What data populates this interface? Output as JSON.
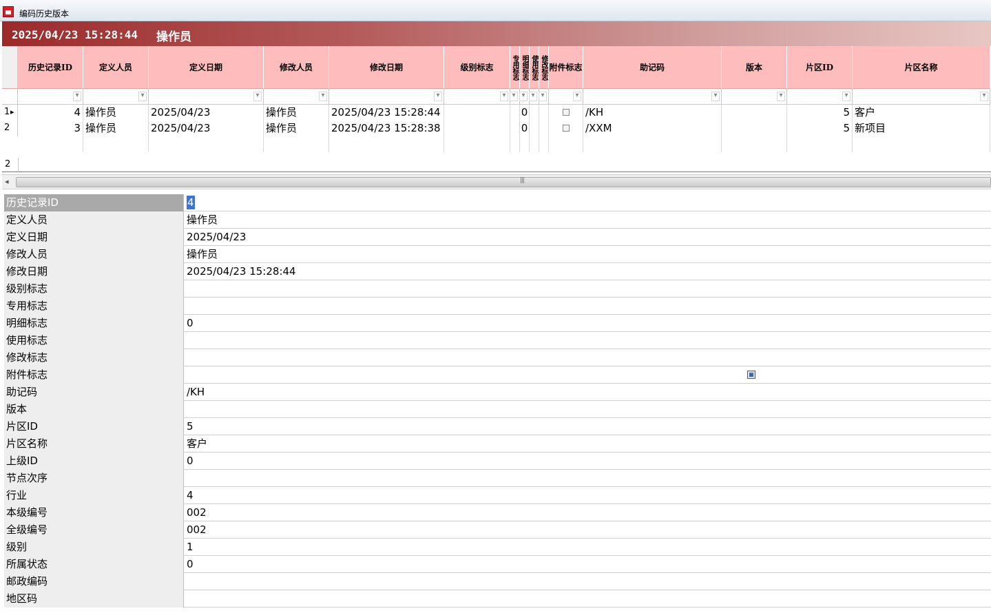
{
  "window": {
    "title": "编码历史版本"
  },
  "banner": {
    "datetime": "2025/04/23 15:28:44",
    "user": "操作员"
  },
  "grid": {
    "columns": [
      {
        "key": "id",
        "label": "历史记录ID"
      },
      {
        "key": "creator",
        "label": "定义人员"
      },
      {
        "key": "created",
        "label": "定义日期"
      },
      {
        "key": "modifier",
        "label": "修改人员"
      },
      {
        "key": "modified",
        "label": "修改日期"
      },
      {
        "key": "level_flag",
        "label": "级别标志"
      },
      {
        "key": "special_flag",
        "label": "专用标志"
      },
      {
        "key": "detail_flag",
        "label": "明细标志"
      },
      {
        "key": "use_flag",
        "label": "使用标志"
      },
      {
        "key": "modify_flag",
        "label": "修改标志"
      },
      {
        "key": "attach_flag",
        "label": "附件标志"
      },
      {
        "key": "mnemonic",
        "label": "助记码"
      },
      {
        "key": "version",
        "label": "版本"
      },
      {
        "key": "zone_id",
        "label": "片区ID"
      },
      {
        "key": "zone_name",
        "label": "片区名称"
      }
    ],
    "rows": [
      {
        "rownum": "1",
        "id": "4",
        "creator": "操作员",
        "created": "2025/04/23",
        "modifier": "操作员",
        "modified": "2025/04/23 15:28:44",
        "detail_flag": "0",
        "mnemonic": "/KH",
        "zone_id": "5",
        "zone_name": "客户"
      },
      {
        "rownum": "2",
        "id": "3",
        "creator": "操作员",
        "created": "2025/04/23",
        "modifier": "操作员",
        "modified": "2025/04/23 15:28:38",
        "detail_flag": "0",
        "mnemonic": "/XXM",
        "zone_id": "5",
        "zone_name": "新项目"
      }
    ],
    "record_count": "2"
  },
  "detail": {
    "fields": [
      {
        "label": "历史记录ID",
        "value": "4"
      },
      {
        "label": "定义人员",
        "value": "操作员"
      },
      {
        "label": "定义日期",
        "value": "2025/04/23"
      },
      {
        "label": "修改人员",
        "value": "操作员"
      },
      {
        "label": "修改日期",
        "value": "2025/04/23 15:28:44"
      },
      {
        "label": "级别标志",
        "value": ""
      },
      {
        "label": "专用标志",
        "value": ""
      },
      {
        "label": "明细标志",
        "value": "0"
      },
      {
        "label": "使用标志",
        "value": ""
      },
      {
        "label": "修改标志",
        "value": ""
      },
      {
        "label": "附件标志",
        "value": ""
      },
      {
        "label": "助记码",
        "value": "/KH"
      },
      {
        "label": "版本",
        "value": ""
      },
      {
        "label": "片区ID",
        "value": "5"
      },
      {
        "label": "片区名称",
        "value": "客户"
      },
      {
        "label": "上级ID",
        "value": "0"
      },
      {
        "label": "节点次序",
        "value": ""
      },
      {
        "label": "行业",
        "value": "4"
      },
      {
        "label": "本级编号",
        "value": "002"
      },
      {
        "label": "全级编号",
        "value": "002"
      },
      {
        "label": "级别",
        "value": "1"
      },
      {
        "label": "所属状态",
        "value": "0"
      },
      {
        "label": "邮政编码",
        "value": ""
      },
      {
        "label": "地区码",
        "value": ""
      }
    ]
  },
  "colors": {
    "header_bg": "#ffbcbc",
    "banner_start": "#9b2b2b",
    "selection": "#3b73d9"
  }
}
